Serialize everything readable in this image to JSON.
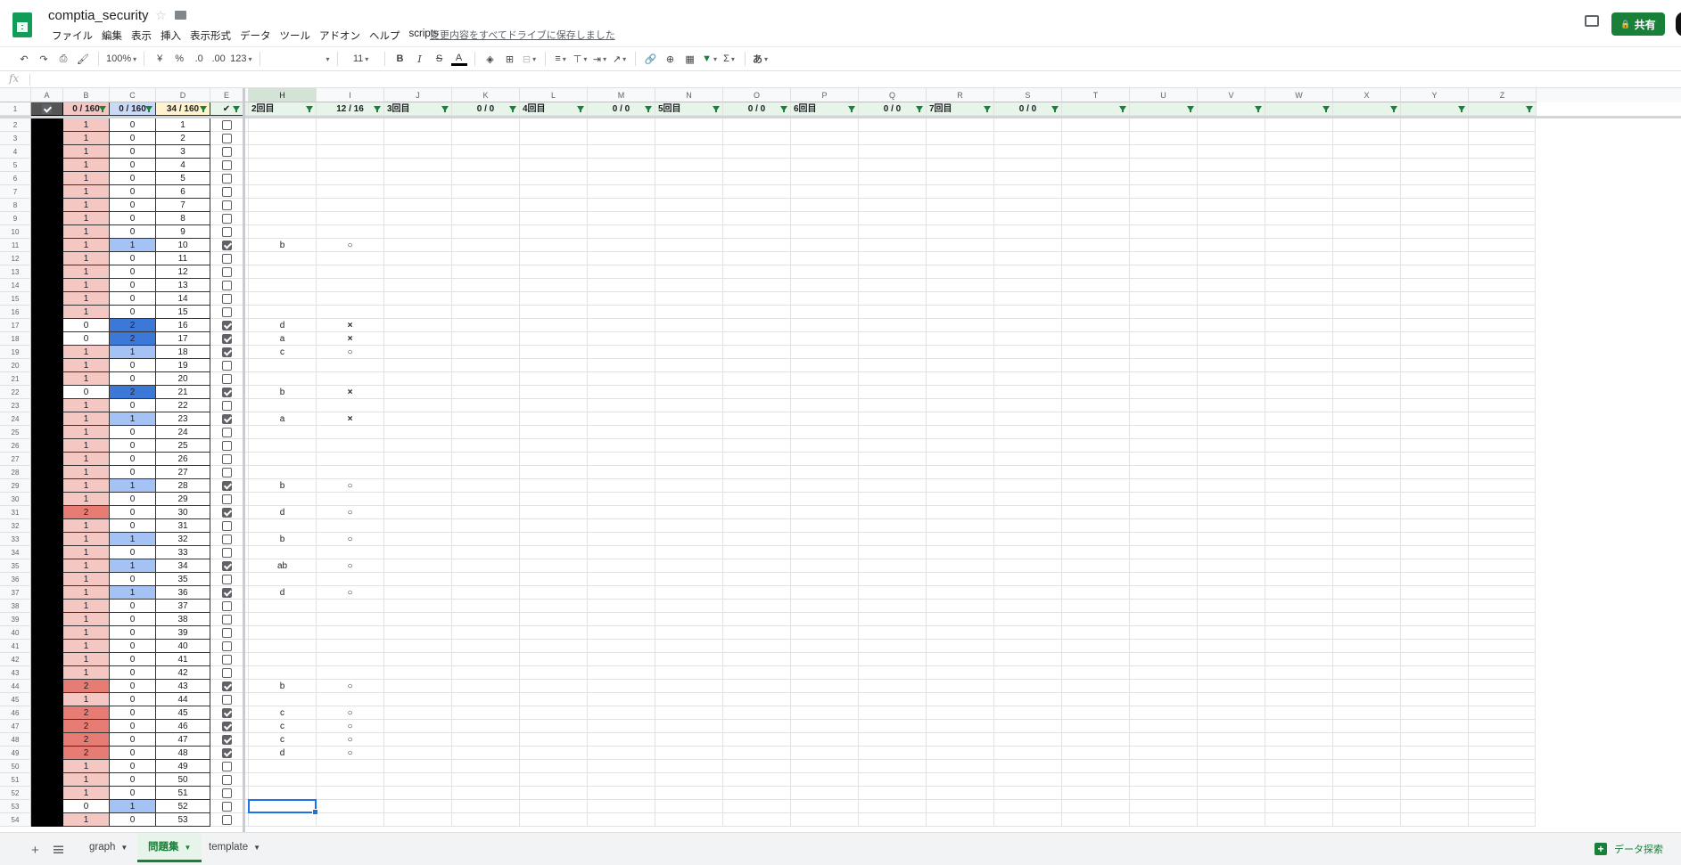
{
  "doc": {
    "title": "comptia_security",
    "star_icon": "☆",
    "save_status": "変更内容をすべてドライブに保存しました"
  },
  "menu": [
    "ファイル",
    "編集",
    "表示",
    "挿入",
    "表示形式",
    "データ",
    "ツール",
    "アドオン",
    "ヘルプ",
    "scripts"
  ],
  "share_label": "共有",
  "toolbar": {
    "zoom": "100%",
    "currency": "¥",
    "percent": "%",
    "dec_less": ".0",
    "dec_more": ".00",
    "format": "123",
    "font_name": "",
    "font_size": "11",
    "bold": "B",
    "italic": "I",
    "strike": "S",
    "text_color": "A",
    "sigma": "Σ",
    "input_tool": "あ"
  },
  "formula_bar": {
    "label": "fx",
    "value": ""
  },
  "columns": [
    "A",
    "B",
    "C",
    "D",
    "E",
    "",
    "H",
    "I",
    "J",
    "K",
    "L",
    "M",
    "N",
    "O",
    "P",
    "Q",
    "R",
    "S",
    "T",
    "U",
    "V",
    "W",
    "X",
    "Y",
    "Z"
  ],
  "header_row": {
    "row_number": "1",
    "B": "0 / 160",
    "C": "0 / 160",
    "D": "34 / 160",
    "E": "✔",
    "cells": [
      "2回目",
      "12 / 16",
      "3回目",
      "0 / 0",
      "4回目",
      "0 / 0",
      "5回目",
      "0 / 0",
      "6回目",
      "0 / 0",
      "7回目",
      "0 / 0",
      "",
      "",
      "",
      "",
      "",
      "",
      ""
    ]
  },
  "rows": [
    {
      "n": "2",
      "b": "1",
      "c": "0",
      "d": "1",
      "e": false,
      "h": "",
      "i": ""
    },
    {
      "n": "3",
      "b": "1",
      "c": "0",
      "d": "2",
      "e": false,
      "h": "",
      "i": ""
    },
    {
      "n": "4",
      "b": "1",
      "c": "0",
      "d": "3",
      "e": false,
      "h": "",
      "i": ""
    },
    {
      "n": "5",
      "b": "1",
      "c": "0",
      "d": "4",
      "e": false,
      "h": "",
      "i": ""
    },
    {
      "n": "6",
      "b": "1",
      "c": "0",
      "d": "5",
      "e": false,
      "h": "",
      "i": ""
    },
    {
      "n": "7",
      "b": "1",
      "c": "0",
      "d": "6",
      "e": false,
      "h": "",
      "i": ""
    },
    {
      "n": "8",
      "b": "1",
      "c": "0",
      "d": "7",
      "e": false,
      "h": "",
      "i": ""
    },
    {
      "n": "9",
      "b": "1",
      "c": "0",
      "d": "8",
      "e": false,
      "h": "",
      "i": ""
    },
    {
      "n": "10",
      "b": "1",
      "c": "0",
      "d": "9",
      "e": false,
      "h": "",
      "i": ""
    },
    {
      "n": "11",
      "b": "1",
      "c": "1",
      "d": "10",
      "e": true,
      "h": "b",
      "i": "○"
    },
    {
      "n": "12",
      "b": "1",
      "c": "0",
      "d": "11",
      "e": false,
      "h": "",
      "i": ""
    },
    {
      "n": "13",
      "b": "1",
      "c": "0",
      "d": "12",
      "e": false,
      "h": "",
      "i": ""
    },
    {
      "n": "14",
      "b": "1",
      "c": "0",
      "d": "13",
      "e": false,
      "h": "",
      "i": ""
    },
    {
      "n": "15",
      "b": "1",
      "c": "0",
      "d": "14",
      "e": false,
      "h": "",
      "i": ""
    },
    {
      "n": "16",
      "b": "1",
      "c": "0",
      "d": "15",
      "e": false,
      "h": "",
      "i": ""
    },
    {
      "n": "17",
      "b": "0",
      "c": "2",
      "d": "16",
      "e": true,
      "h": "d",
      "i": "×"
    },
    {
      "n": "18",
      "b": "0",
      "c": "2",
      "d": "17",
      "e": true,
      "h": "a",
      "i": "×"
    },
    {
      "n": "19",
      "b": "1",
      "c": "1",
      "d": "18",
      "e": true,
      "h": "c",
      "i": "○"
    },
    {
      "n": "20",
      "b": "1",
      "c": "0",
      "d": "19",
      "e": false,
      "h": "",
      "i": ""
    },
    {
      "n": "21",
      "b": "1",
      "c": "0",
      "d": "20",
      "e": false,
      "h": "",
      "i": ""
    },
    {
      "n": "22",
      "b": "0",
      "c": "2",
      "d": "21",
      "e": true,
      "h": "b",
      "i": "×"
    },
    {
      "n": "23",
      "b": "1",
      "c": "0",
      "d": "22",
      "e": false,
      "h": "",
      "i": ""
    },
    {
      "n": "24",
      "b": "1",
      "c": "1",
      "d": "23",
      "e": true,
      "h": "a",
      "i": "×"
    },
    {
      "n": "25",
      "b": "1",
      "c": "0",
      "d": "24",
      "e": false,
      "h": "",
      "i": ""
    },
    {
      "n": "26",
      "b": "1",
      "c": "0",
      "d": "25",
      "e": false,
      "h": "",
      "i": ""
    },
    {
      "n": "27",
      "b": "1",
      "c": "0",
      "d": "26",
      "e": false,
      "h": "",
      "i": ""
    },
    {
      "n": "28",
      "b": "1",
      "c": "0",
      "d": "27",
      "e": false,
      "h": "",
      "i": ""
    },
    {
      "n": "29",
      "b": "1",
      "c": "1",
      "d": "28",
      "e": true,
      "h": "b",
      "i": "○"
    },
    {
      "n": "30",
      "b": "1",
      "c": "0",
      "d": "29",
      "e": false,
      "h": "",
      "i": ""
    },
    {
      "n": "31",
      "b": "2",
      "c": "0",
      "d": "30",
      "e": true,
      "h": "d",
      "i": "○"
    },
    {
      "n": "32",
      "b": "1",
      "c": "0",
      "d": "31",
      "e": false,
      "h": "",
      "i": ""
    },
    {
      "n": "33",
      "b": "1",
      "c": "1",
      "d": "32",
      "e": false,
      "h": "b",
      "i": "○"
    },
    {
      "n": "34",
      "b": "1",
      "c": "0",
      "d": "33",
      "e": false,
      "h": "",
      "i": ""
    },
    {
      "n": "35",
      "b": "1",
      "c": "1",
      "d": "34",
      "e": true,
      "h": "ab",
      "i": "○"
    },
    {
      "n": "36",
      "b": "1",
      "c": "0",
      "d": "35",
      "e": false,
      "h": "",
      "i": ""
    },
    {
      "n": "37",
      "b": "1",
      "c": "1",
      "d": "36",
      "e": true,
      "h": "d",
      "i": "○"
    },
    {
      "n": "38",
      "b": "1",
      "c": "0",
      "d": "37",
      "e": false,
      "h": "",
      "i": ""
    },
    {
      "n": "39",
      "b": "1",
      "c": "0",
      "d": "38",
      "e": false,
      "h": "",
      "i": ""
    },
    {
      "n": "40",
      "b": "1",
      "c": "0",
      "d": "39",
      "e": false,
      "h": "",
      "i": ""
    },
    {
      "n": "41",
      "b": "1",
      "c": "0",
      "d": "40",
      "e": false,
      "h": "",
      "i": ""
    },
    {
      "n": "42",
      "b": "1",
      "c": "0",
      "d": "41",
      "e": false,
      "h": "",
      "i": ""
    },
    {
      "n": "43",
      "b": "1",
      "c": "0",
      "d": "42",
      "e": false,
      "h": "",
      "i": ""
    },
    {
      "n": "44",
      "b": "2",
      "c": "0",
      "d": "43",
      "e": true,
      "h": "b",
      "i": "○"
    },
    {
      "n": "45",
      "b": "1",
      "c": "0",
      "d": "44",
      "e": false,
      "h": "",
      "i": ""
    },
    {
      "n": "46",
      "b": "2",
      "c": "0",
      "d": "45",
      "e": true,
      "h": "c",
      "i": "○"
    },
    {
      "n": "47",
      "b": "2",
      "c": "0",
      "d": "46",
      "e": true,
      "h": "c",
      "i": "○"
    },
    {
      "n": "48",
      "b": "2",
      "c": "0",
      "d": "47",
      "e": true,
      "h": "c",
      "i": "○"
    },
    {
      "n": "49",
      "b": "2",
      "c": "0",
      "d": "48",
      "e": true,
      "h": "d",
      "i": "○"
    },
    {
      "n": "50",
      "b": "1",
      "c": "0",
      "d": "49",
      "e": false,
      "h": "",
      "i": ""
    },
    {
      "n": "51",
      "b": "1",
      "c": "0",
      "d": "50",
      "e": false,
      "h": "",
      "i": ""
    },
    {
      "n": "52",
      "b": "1",
      "c": "0",
      "d": "51",
      "e": false,
      "h": "",
      "i": ""
    },
    {
      "n": "53",
      "b": "0",
      "c": "1",
      "d": "52",
      "e": false,
      "h": "",
      "i": ""
    },
    {
      "n": "54",
      "b": "1",
      "c": "0",
      "d": "53",
      "e": false,
      "h": "",
      "i": ""
    }
  ],
  "colors": {
    "b_0": "#ffffff",
    "b_1": "#f4c7c3",
    "b_2": "#e67c73",
    "c_0": "#ffffff",
    "c_1": "#a4c2f4",
    "c_2": "#3c78d8",
    "header_fill": "#e6f4ea",
    "b_header": "#f4c7c3",
    "c_header": "#c9daf8",
    "d_header": "#fff2cc",
    "accent": "#188038"
  },
  "sheets": [
    {
      "label": "graph",
      "active": false
    },
    {
      "label": "問題集",
      "active": true
    },
    {
      "label": "template",
      "active": false
    }
  ],
  "explore_label": "データ探索",
  "add_sheet_icon": "+"
}
